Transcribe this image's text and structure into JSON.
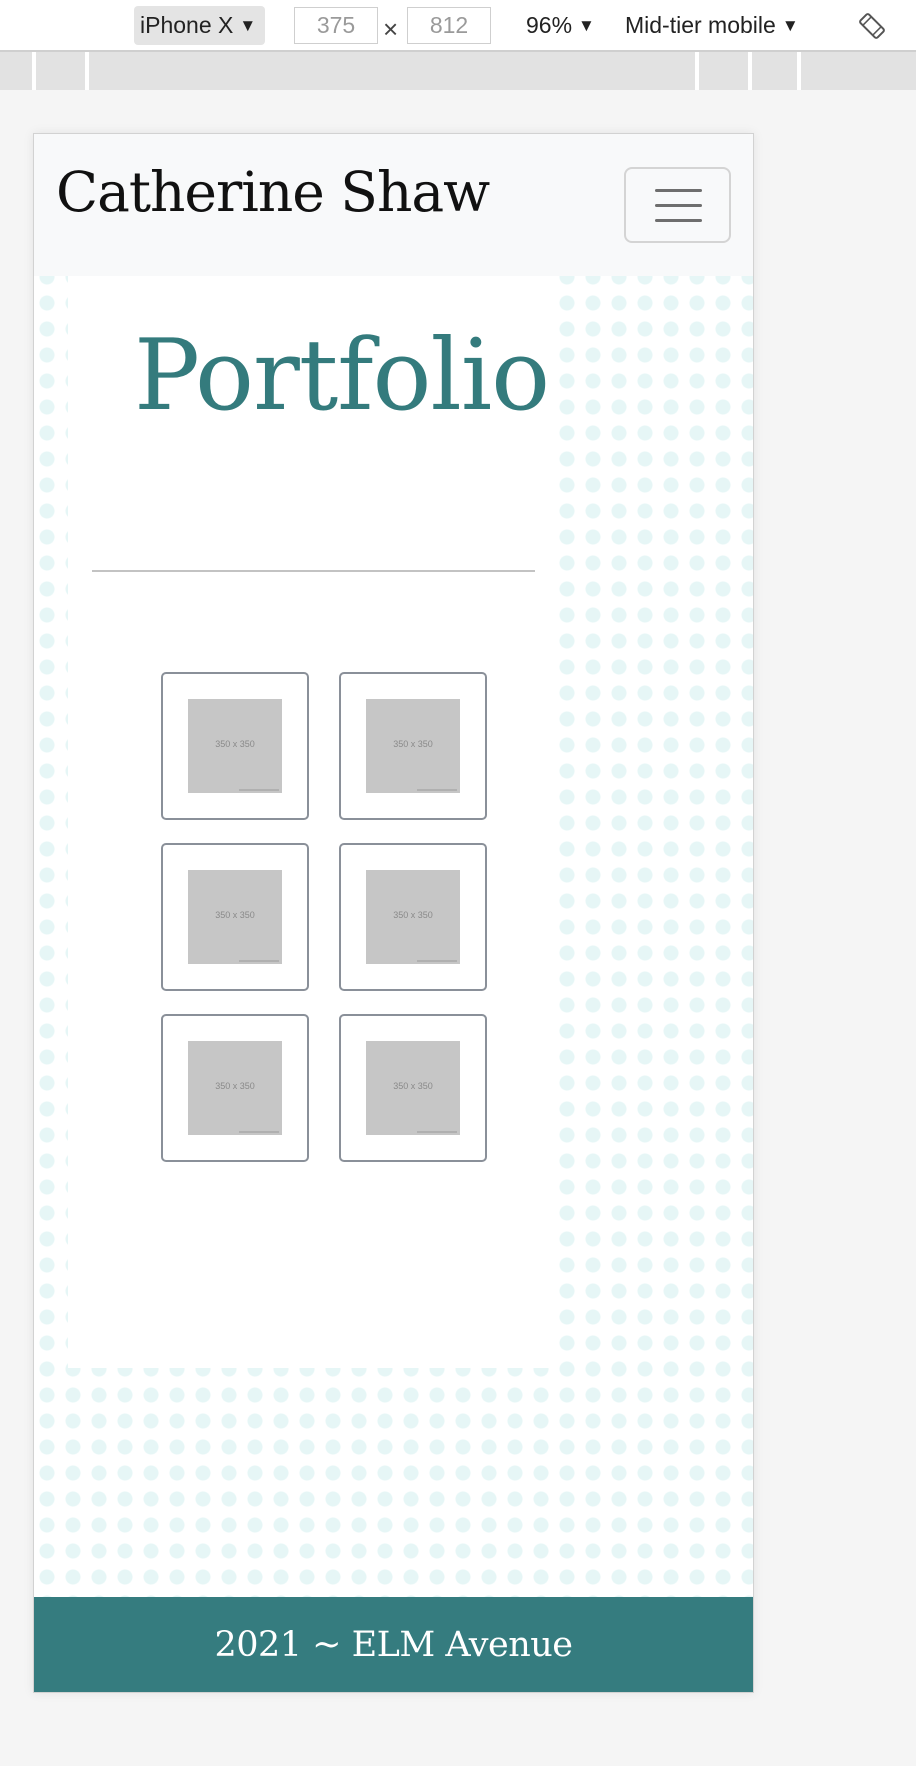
{
  "devtools": {
    "device": "iPhone X",
    "width": "375",
    "times": "×",
    "height": "812",
    "zoom": "96%",
    "throttle": "Mid-tier mobile",
    "rotate_icon": "rotate-icon"
  },
  "site": {
    "brand": "Catherine Shaw",
    "menu_icon": "hamburger-icon",
    "heading": "Portfolio",
    "gallery": [
      {
        "label": "350 x 350"
      },
      {
        "label": "350 x 350"
      },
      {
        "label": "350 x 350"
      },
      {
        "label": "350 x 350"
      },
      {
        "label": "350 x 350"
      },
      {
        "label": "350 x 350"
      }
    ],
    "footer": "2021 ~ ELM Avenue"
  },
  "colors": {
    "accent": "#357c7f",
    "heading": "#347b7d",
    "nav_bg": "#f8f9fa",
    "dots": "#e6f6f6"
  }
}
